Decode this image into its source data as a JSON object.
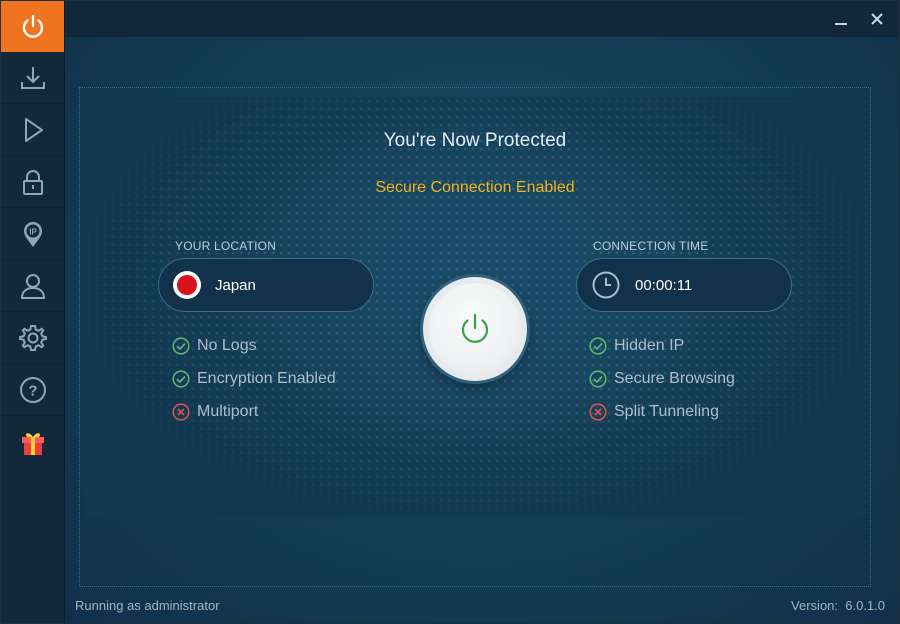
{
  "sidebar": {
    "items": [
      {
        "name": "power-icon",
        "active": true
      },
      {
        "name": "download-icon"
      },
      {
        "name": "play-icon"
      },
      {
        "name": "lock-icon"
      },
      {
        "name": "ip-pin-icon",
        "glyph": "IP"
      },
      {
        "name": "user-icon"
      },
      {
        "name": "gear-icon"
      },
      {
        "name": "help-icon",
        "glyph": "?"
      },
      {
        "name": "gift-icon"
      }
    ]
  },
  "window_controls": {
    "minimize": "minimize-icon",
    "close": "close-icon"
  },
  "main": {
    "title": "You're Now Protected",
    "subtitle": "Secure Connection Enabled",
    "location": {
      "label": "YOUR LOCATION",
      "country": "Japan"
    },
    "connection": {
      "label": "CONNECTION TIME",
      "time": "00:00:11"
    },
    "features_left": [
      {
        "text": "No Logs",
        "status": "enabled"
      },
      {
        "text": "Encryption Enabled",
        "status": "enabled"
      },
      {
        "text": "Multiport",
        "status": "disabled"
      }
    ],
    "features_right": [
      {
        "text": "Hidden IP",
        "status": "enabled"
      },
      {
        "text": "Secure Browsing",
        "status": "enabled"
      },
      {
        "text": "Split Tunneling",
        "status": "disabled"
      }
    ]
  },
  "status": {
    "left": "Running as administrator",
    "right": "Version:  6.0.1.0"
  },
  "colors": {
    "accent": "#f07320",
    "subtitle": "#f5b21c",
    "enabled": "#5fb36e",
    "disabled": "#d9534f",
    "power_green": "#3aa047"
  }
}
